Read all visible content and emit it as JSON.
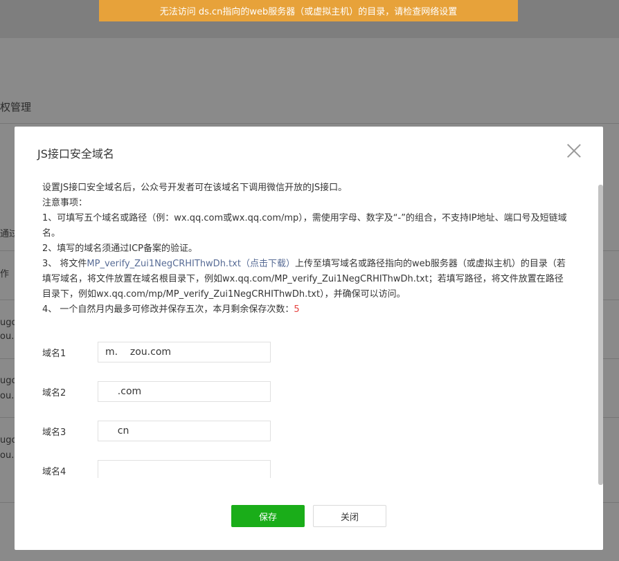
{
  "toast": {
    "text": "无法访问 ds.cn指向的web服务器（或虚拟主机）的目录，请检查网络设置"
  },
  "background": {
    "section_title": "权管理",
    "cells": [
      "通过",
      "作",
      "ugo",
      "ou.",
      "ugo",
      "ou.",
      "ugo",
      "ou."
    ]
  },
  "dialog": {
    "title": "JS接口安全域名",
    "description": {
      "intro": "设置JS接口安全域名后，公众号开发者可在该域名下调用微信开放的JS接口。",
      "notice": "注意事项：",
      "item1": "1、可填写五个域名或路径（例：wx.qq.com或wx.qq.com/mp），需使用字母、数字及“-”的组合，不支持IP地址、端口号及短链域名。",
      "item2": "2、填写的域名须通过ICP备案的验证。",
      "item3_prefix": "3、 将文件",
      "item3_link": "MP_verify_Zui1NegCRHIThwDh.txt（点击下载）",
      "item3_suffix": "上传至填写域名或路径指向的web服务器（或虚拟主机）的目录（若填写域名，将文件放置在域名根目录下，例如wx.qq.com/MP_verify_Zui1NegCRHIThwDh.txt；若填写路径，将文件放置在路径目录下，例如wx.qq.com/mp/MP_verify_Zui1NegCRHIThwDh.txt），并确保可以访问。",
      "item4_prefix": "4、 一个自然月内最多可修改并保存五次，本月剩余保存次数：",
      "item4_count": "5"
    },
    "fields": [
      {
        "label": "域名1",
        "value": "m.    zou.com"
      },
      {
        "label": "域名2",
        "value": "    .com"
      },
      {
        "label": "域名3",
        "value": "    cn"
      },
      {
        "label": "域名4",
        "value": ""
      }
    ],
    "buttons": {
      "save": "保存",
      "close": "关闭"
    }
  }
}
